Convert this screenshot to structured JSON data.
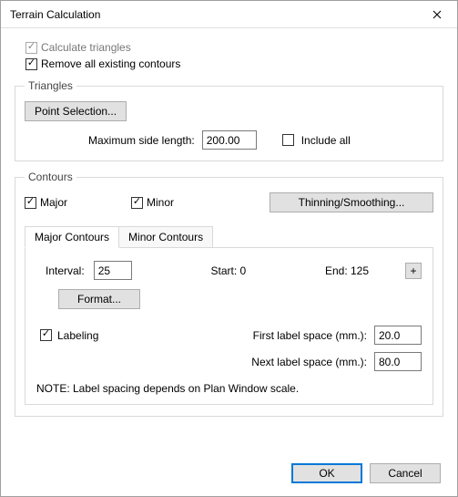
{
  "window": {
    "title": "Terrain Calculation"
  },
  "checks": {
    "calc_triangles": "Calculate triangles",
    "remove_contours": "Remove all existing contours"
  },
  "triangles": {
    "legend": "Triangles",
    "point_selection": "Point Selection...",
    "max_side_label": "Maximum side length:",
    "max_side_value": "200.00",
    "include_all": "Include all"
  },
  "contours": {
    "legend": "Contours",
    "major": "Major",
    "minor": "Minor",
    "thinning": "Thinning/Smoothing...",
    "tab_major": "Major Contours",
    "tab_minor": "Minor Contours",
    "interval_label": "Interval:",
    "interval_value": "25",
    "start_label": "Start: 0",
    "end_label": "End: 125",
    "plus": "+",
    "format": "Format...",
    "labeling": "Labeling",
    "first_label": "First label space (mm.):",
    "first_value": "20.0",
    "next_label": "Next label space (mm.):",
    "next_value": "80.0",
    "note": "NOTE: Label spacing depends on Plan Window scale."
  },
  "buttons": {
    "ok": "OK",
    "cancel": "Cancel"
  }
}
